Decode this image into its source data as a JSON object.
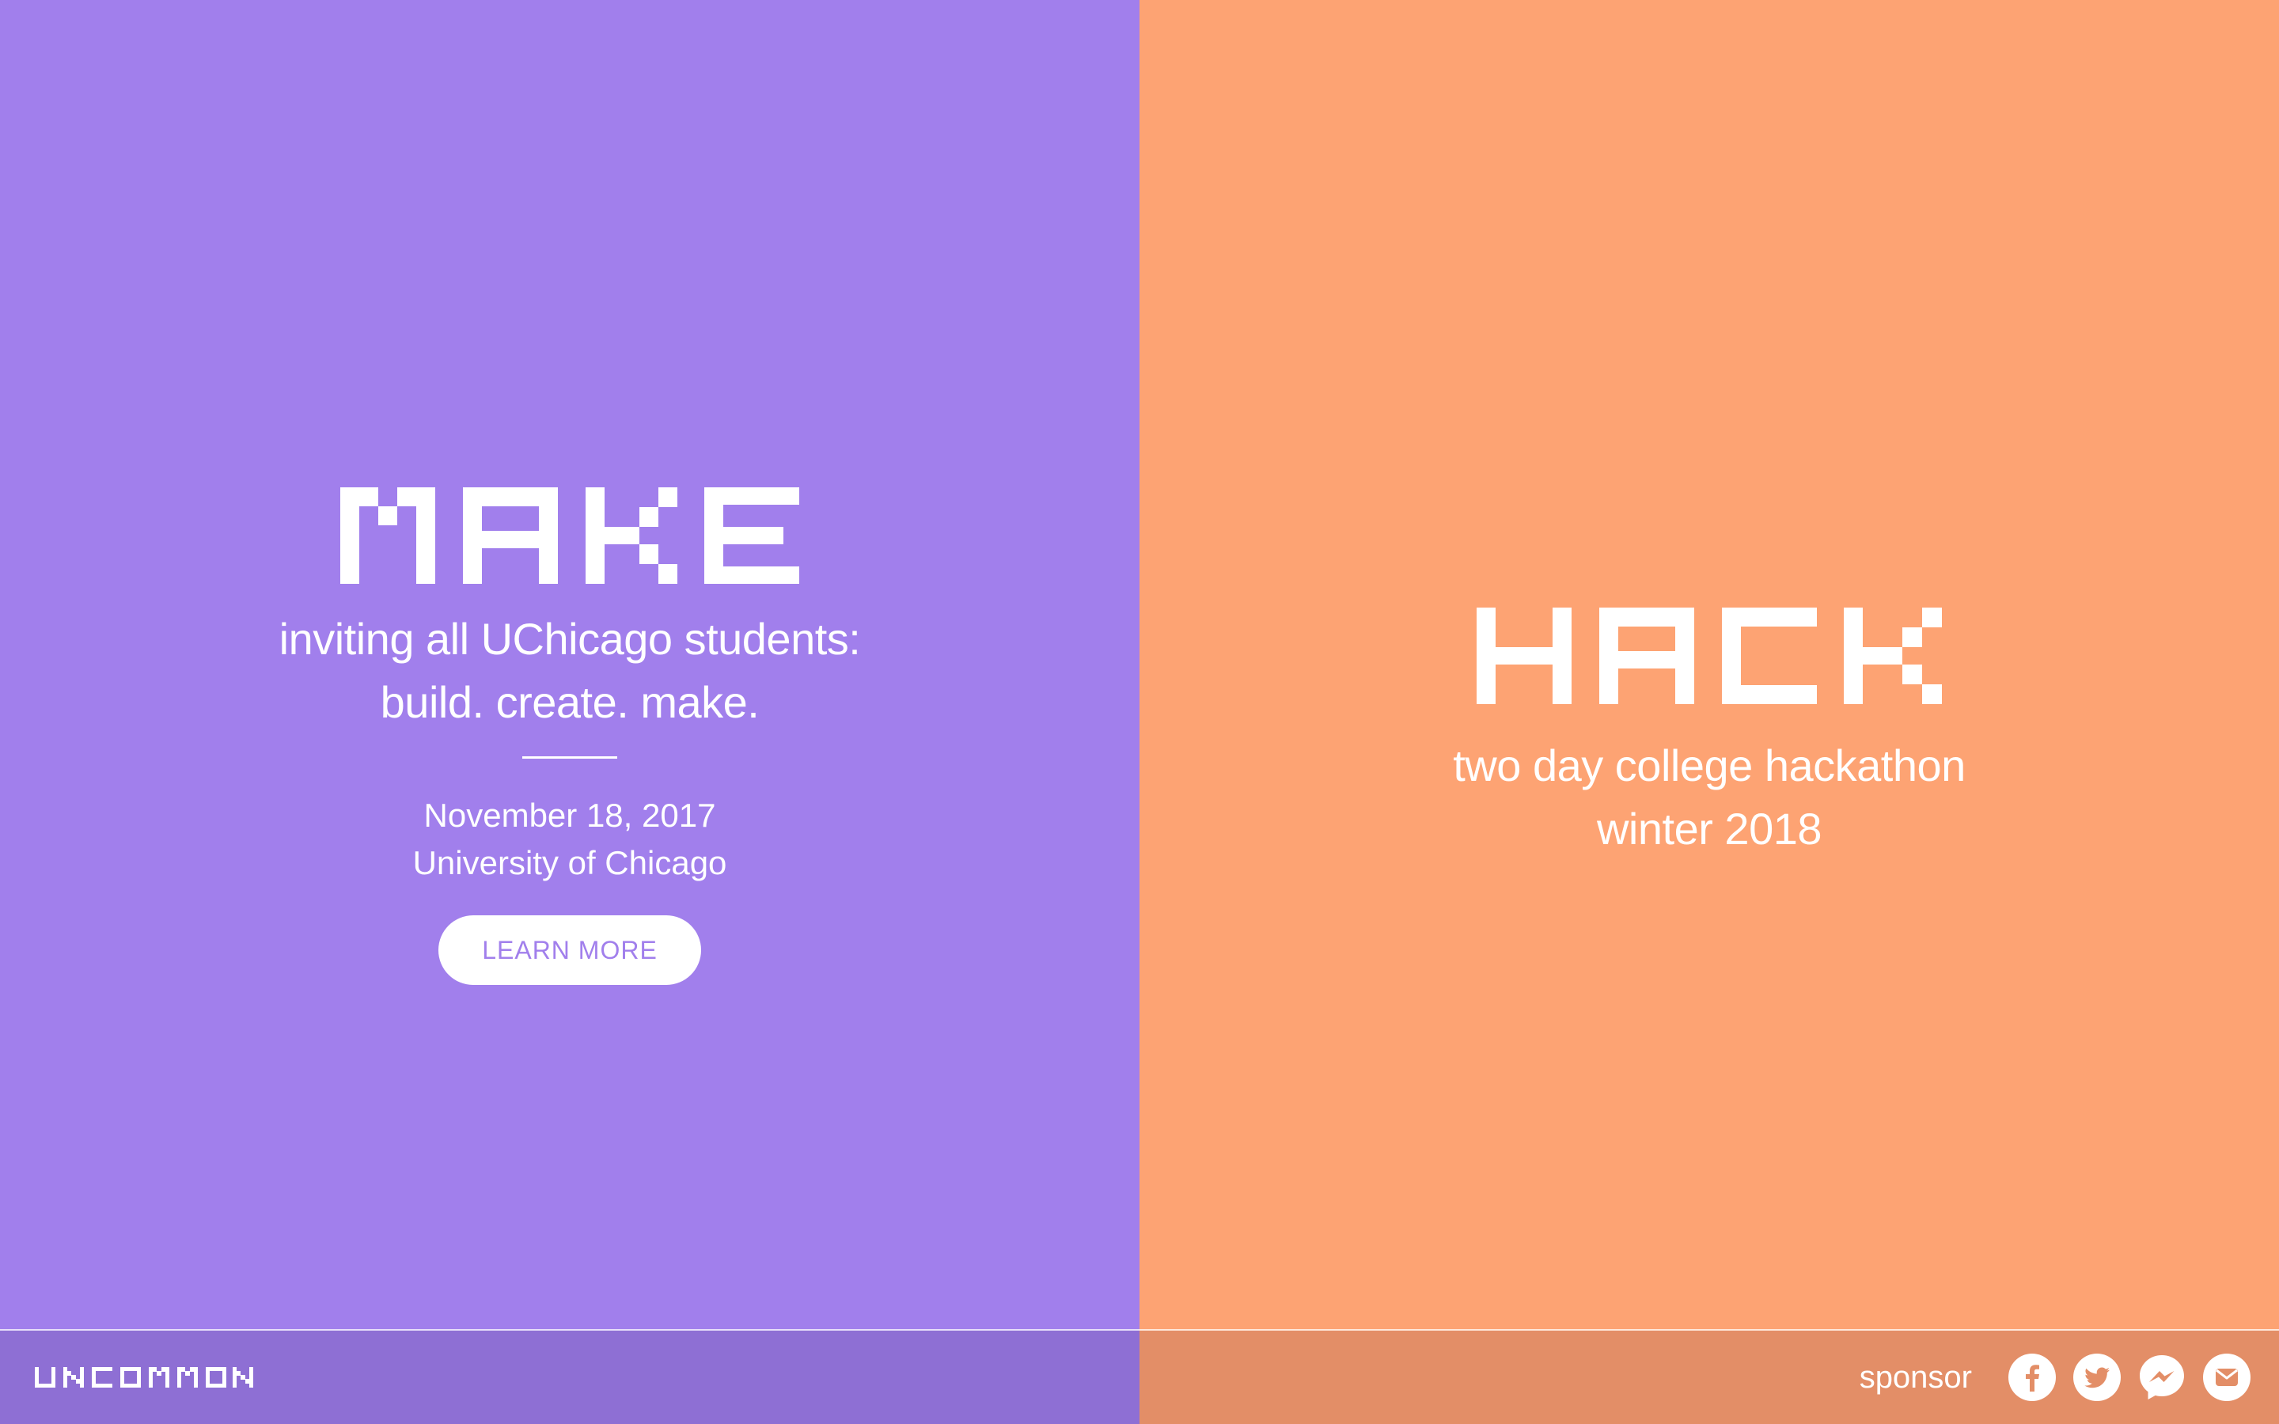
{
  "colors": {
    "make_bg": "#a17fec",
    "hack_bg": "#fda373",
    "footer_left_bg": "#8e6fd4",
    "footer_right_bg": "#e38e67",
    "text": "#ffffff"
  },
  "make": {
    "title": "MAKE",
    "tagline_line1": "inviting all UChicago students:",
    "tagline_line2": "build. create. make.",
    "date": "November 18, 2017",
    "location": "University of Chicago",
    "button_label": "LEARN MORE"
  },
  "hack": {
    "title": "HACK",
    "tagline_line1": "two day college hackathon",
    "tagline_line2": "winter 2018"
  },
  "footer": {
    "logo_text": "UNCOMMON",
    "sponsor_label": "sponsor",
    "social_icons": [
      "facebook-icon",
      "twitter-icon",
      "messenger-icon",
      "email-icon"
    ]
  }
}
